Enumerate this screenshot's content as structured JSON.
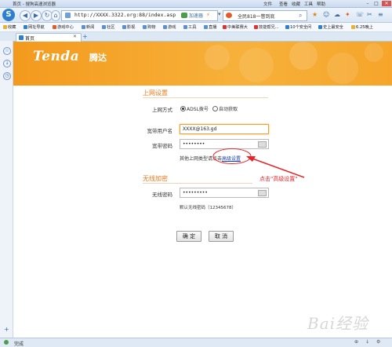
{
  "titlebar": {
    "title": "首页 - 搜狗高速浏览器",
    "menu": [
      "文件",
      "查看",
      "收藏",
      "工具",
      "帮助"
    ]
  },
  "navbar": {
    "url": "http://XXXX.3322.org:88/index.asp",
    "accelerate": "加速器",
    "search_text": "全民818一瞥到底"
  },
  "favbar": {
    "items": [
      "收藏",
      "网址导航",
      "游戏中心",
      "新闻",
      "社区",
      "影视",
      "购物",
      "游戏",
      "工具",
      "直播",
      "中美联赛大",
      "技能帮兄...",
      "10个安全问",
      "史上最安全",
      "6.25晚上"
    ]
  },
  "tabs": [
    {
      "label": "首页"
    }
  ],
  "brand": {
    "name": "Tenda",
    "name_cn": "腾达"
  },
  "form": {
    "section_internet": "上网设置",
    "mode_label": "上网方式",
    "mode_option_adsl": "ADSL拨号",
    "mode_option_auto": "自动获取",
    "username_label": "宽带用户名",
    "username_value": "XXXX@163.gd",
    "password_label": "宽带密码",
    "password_value": "••••••••",
    "other_text_prefix": "其他上网类型请点击",
    "advanced_link": "高级设置",
    "section_wireless": "无线加密",
    "wireless_label": "无线密码",
    "wireless_value": "•••••••••",
    "wireless_hint": "默认无线密码（12345678）",
    "ok_button": "确 定",
    "cancel_button": "取 消"
  },
  "annotation": {
    "text": "点击\"高级设置\"",
    "color": "#e8242a"
  },
  "statusbar": {
    "text": "完成"
  },
  "colors": {
    "accent_orange": "#f39a1e",
    "section_orange": "#e47a1c",
    "browser_blue": "#2d7fd1"
  }
}
